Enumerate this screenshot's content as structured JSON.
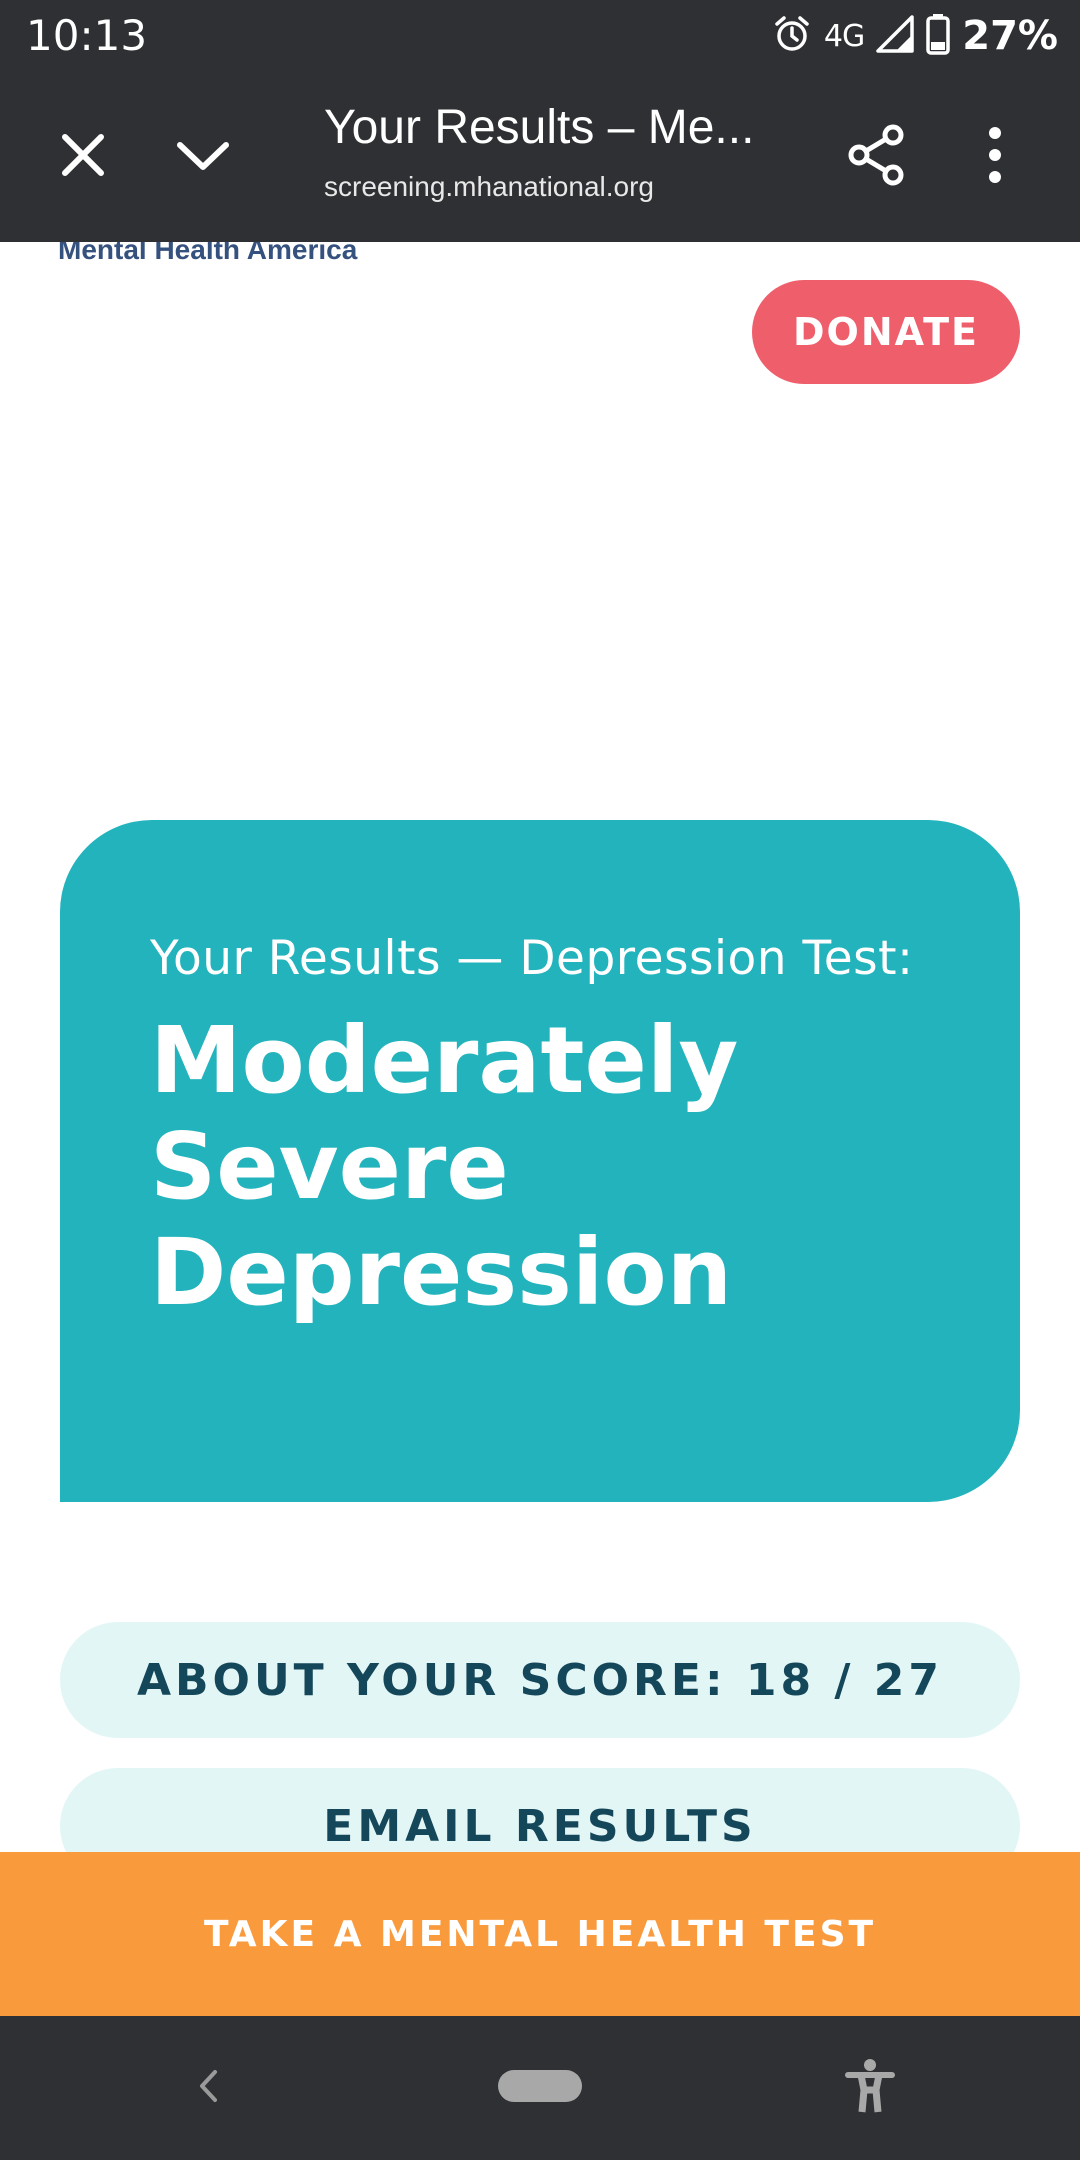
{
  "status_bar": {
    "time": "10:13",
    "network": "4G",
    "battery": "27%",
    "icons": [
      "alarm-icon",
      "signal-icon",
      "battery-icon"
    ]
  },
  "browser": {
    "title": "Your Results – Me...",
    "url": "screening.mhanational.org",
    "icons": [
      "close-icon",
      "chevron-down-icon",
      "share-icon",
      "more-vert-icon"
    ]
  },
  "page": {
    "org_name": "Mental Health America",
    "donate_label": "DONATE",
    "result": {
      "label": "Your Results — Depression Test:",
      "value": "Moderately Severe Depression"
    },
    "score_button": "ABOUT YOUR SCORE: 18 / 27",
    "email_button": "EMAIL RESULTS",
    "cta": "TAKE A MENTAL HEALTH TEST"
  },
  "colors": {
    "chrome": "#2f3033",
    "donate": "#ee5f6b",
    "card": "#22b3bc",
    "pill": "#e3f6f6",
    "pill_text": "#14475a",
    "cta": "#f99a3d",
    "org_text": "#35517e"
  },
  "nav": {
    "icons": [
      "back-icon",
      "home-pill-icon",
      "accessibility-icon"
    ]
  }
}
